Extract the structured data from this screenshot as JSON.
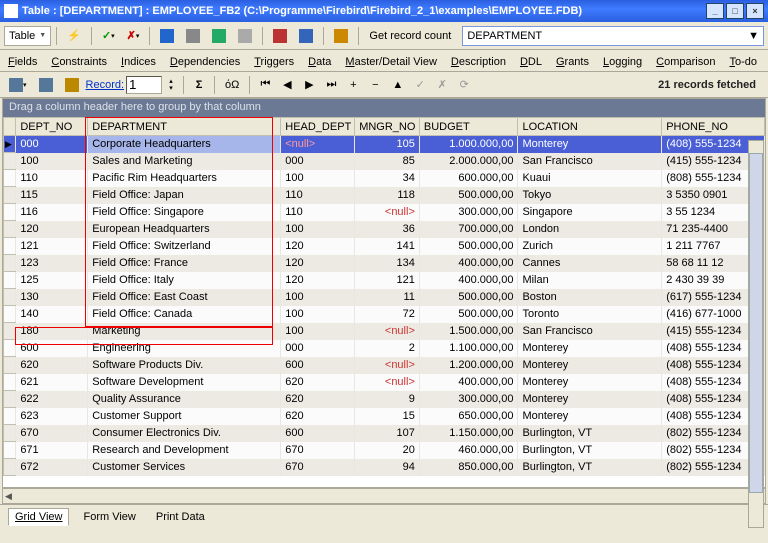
{
  "window": {
    "title": "Table : [DEPARTMENT] : EMPLOYEE_FB2 (C:\\Programme\\Firebird\\Firebird_2_1\\examples\\EMPLOYEE.FDB)"
  },
  "toolbar1": {
    "tableMenu": "Table",
    "getRecordCount": "Get record count",
    "deptCombo": "DEPARTMENT"
  },
  "tabs": [
    "Fields",
    "Constraints",
    "Indices",
    "Dependencies",
    "Triggers",
    "Data",
    "Master/Detail View",
    "Description",
    "DDL",
    "Grants",
    "Logging",
    "Comparison",
    "To-do"
  ],
  "toolbar2": {
    "recordLabel": "Record:",
    "recordValue": "1",
    "fetched": "21 records fetched"
  },
  "grid": {
    "groupHint": "Drag a column header here to group by that column",
    "columns": [
      "DEPT_NO",
      "DEPARTMENT",
      "HEAD_DEPT",
      "MNGR_NO",
      "BUDGET",
      "LOCATION",
      "PHONE_NO"
    ],
    "rows": [
      {
        "sel": true,
        "ind": "▶",
        "c": [
          "000",
          "Corporate Headquarters",
          "<null>",
          "105",
          "1.000.000,00",
          "Monterey",
          "(408) 555-1234"
        ],
        "nul": [
          2
        ]
      },
      {
        "c": [
          "100",
          "Sales and Marketing",
          "000",
          "85",
          "2.000.000,00",
          "San Francisco",
          "(415) 555-1234"
        ]
      },
      {
        "c": [
          "110",
          "Pacific Rim Headquarters",
          "100",
          "34",
          "600.000,00",
          "Kuaui",
          "(808) 555-1234"
        ]
      },
      {
        "c": [
          "115",
          "Field Office: Japan",
          "110",
          "118",
          "500.000,00",
          "Tokyo",
          "3 5350 0901"
        ]
      },
      {
        "c": [
          "116",
          "Field Office: Singapore",
          "110",
          "<null>",
          "300.000,00",
          "Singapore",
          "3 55 1234"
        ],
        "nul": [
          3
        ]
      },
      {
        "c": [
          "120",
          "European Headquarters",
          "100",
          "36",
          "700.000,00",
          "London",
          "71 235-4400"
        ]
      },
      {
        "c": [
          "121",
          "Field Office: Switzerland",
          "120",
          "141",
          "500.000,00",
          "Zurich",
          "1 211 7767"
        ]
      },
      {
        "c": [
          "123",
          "Field Office: France",
          "120",
          "134",
          "400.000,00",
          "Cannes",
          "58 68 11 12"
        ]
      },
      {
        "c": [
          "125",
          "Field Office: Italy",
          "120",
          "121",
          "400.000,00",
          "Milan",
          "2 430 39 39"
        ]
      },
      {
        "c": [
          "130",
          "Field Office: East Coast",
          "100",
          "11",
          "500.000,00",
          "Boston",
          "(617) 555-1234"
        ]
      },
      {
        "c": [
          "140",
          "Field Office: Canada",
          "100",
          "72",
          "500.000,00",
          "Toronto",
          "(416) 677-1000"
        ]
      },
      {
        "c": [
          "180",
          "Marketing",
          "100",
          "<null>",
          "1.500.000,00",
          "San Francisco",
          "(415) 555-1234"
        ],
        "nul": [
          3
        ]
      },
      {
        "c": [
          "600",
          "Engineering",
          "000",
          "2",
          "1.100.000,00",
          "Monterey",
          "(408) 555-1234"
        ]
      },
      {
        "c": [
          "620",
          "Software Products Div.",
          "600",
          "<null>",
          "1.200.000,00",
          "Monterey",
          "(408) 555-1234"
        ],
        "nul": [
          3
        ]
      },
      {
        "c": [
          "621",
          "Software Development",
          "620",
          "<null>",
          "400.000,00",
          "Monterey",
          "(408) 555-1234"
        ],
        "nul": [
          3
        ]
      },
      {
        "c": [
          "622",
          "Quality Assurance",
          "620",
          "9",
          "300.000,00",
          "Monterey",
          "(408) 555-1234"
        ]
      },
      {
        "c": [
          "623",
          "Customer Support",
          "620",
          "15",
          "650.000,00",
          "Monterey",
          "(408) 555-1234"
        ]
      },
      {
        "c": [
          "670",
          "Consumer Electronics Div.",
          "600",
          "107",
          "1.150.000,00",
          "Burlington, VT",
          "(802) 555-1234"
        ]
      },
      {
        "c": [
          "671",
          "Research and Development",
          "670",
          "20",
          "460.000,00",
          "Burlington, VT",
          "(802) 555-1234"
        ]
      },
      {
        "c": [
          "672",
          "Customer Services",
          "670",
          "94",
          "850.000,00",
          "Burlington, VT",
          "(802) 555-1234"
        ]
      }
    ]
  },
  "bottomTabs": {
    "gridView": "Grid View",
    "formView": "Form View",
    "printData": "Print Data"
  }
}
